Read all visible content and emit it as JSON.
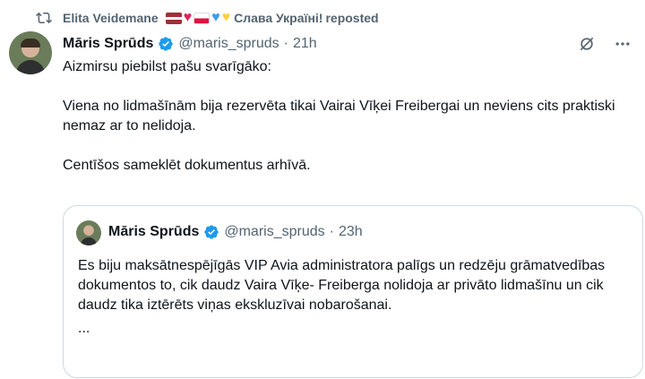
{
  "repost": {
    "user": "Elita Veidemane",
    "status": "Слава Україні!",
    "suffix": "reposted"
  },
  "tweet": {
    "author_name": "Māris Sprūds",
    "handle": "@maris_spruds",
    "separator": "·",
    "time": "21h",
    "paragraphs": [
      "Aizmirsu piebilst pašu svarīgāko:",
      "Viena no lidmašīnām bija rezervēta tikai Vairai Vīķei Freibergai un neviens cits praktiski nemaz ar to nelidoja.",
      "Centīšos sameklēt dokumentus arhīvā."
    ]
  },
  "quote": {
    "author_name": "Māris Sprūds",
    "handle": "@maris_spruds",
    "separator": "·",
    "time": "23h",
    "text": "Es biju maksātnespējīgās VIP Avia administratora palīgs un redzēju grāmatvedības dokumentos to, cik daudz Vaira Vīķe- Freiberga nolidoja ar privāto lidmašīnu un cik daudz tika iztērēts viņas ekskluzīvai nobarošanai.",
    "ellipsis": "..."
  },
  "colors": {
    "text": "#0f1419",
    "secondary": "#536471",
    "verified": "#1d9bf0",
    "border": "#cfd9de"
  },
  "icons": [
    "repost-icon",
    "verified-badge-icon",
    "grok-icon",
    "more-icon"
  ]
}
